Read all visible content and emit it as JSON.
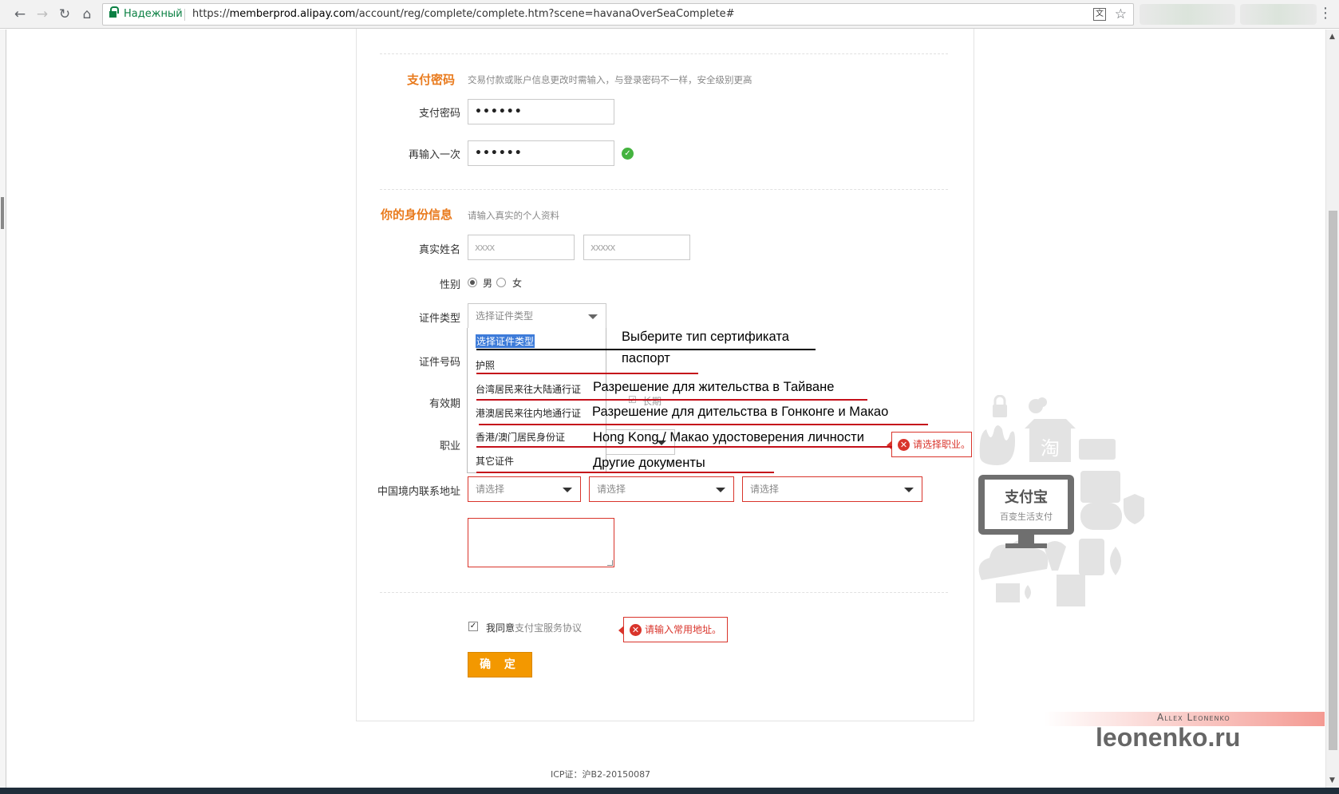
{
  "browser": {
    "secure_label": "Надежный",
    "url_prefix": "https://",
    "url_domain": "memberprod.alipay.com",
    "url_path": "/account/reg/complete/complete.htm?scene=havanaOverSeaComplete#"
  },
  "pay_password": {
    "title": "支付密码",
    "hint": "交易付款或账户信息更改时需输入，与登录密码不一样，安全级别更高",
    "label": "支付密码",
    "value": "••••••",
    "confirm_label": "再输入一次",
    "confirm_value": "••••••"
  },
  "identity": {
    "title": "你的身份信息",
    "hint": "请输入真实的个人资料",
    "real_name_label": "真实姓名",
    "first_name": "xxxx",
    "last_name": "xxxxx",
    "gender_label": "性别",
    "gender_male": "男",
    "gender_female": "女",
    "id_type_label": "证件类型",
    "id_type_placeholder": "选择证件类型",
    "id_type_options": [
      "选择证件类型",
      "护照",
      "台湾居民来往大陆通行证",
      "港澳居民来往内地通行证",
      "香港/澳门居民身份证",
      "其它证件"
    ],
    "id_number_label": "证件号码",
    "validity_label": "有效期",
    "validity_longterm": "长期",
    "occupation_label": "职业",
    "occupation_error": "请选择职业。",
    "address_label": "中国境内联系地址",
    "address_select_1": "请选择",
    "address_select_2": "请选择",
    "address_select_3": "请选择",
    "address_error": "请输入常用地址。"
  },
  "agreement": {
    "prefix": "我同意",
    "link": "支付宝服务协议"
  },
  "submit_label": "确 定",
  "icp": "ICP证：沪B2-20150087",
  "annotations": [
    "Выберите тип сертификата",
    "паспорт",
    "Разрешение для жительства в Тайване",
    "Разрешение для дительства в Гонконге и Макао",
    "Hong Kong / Макао удостоверения личности",
    "Другие документы"
  ],
  "illustration": {
    "brand": "支付宝",
    "slogan": "百变生活支付",
    "taobao_char": "淘"
  },
  "watermark": {
    "name": "Allex Leonenko",
    "site": "leonenko.ru"
  },
  "colors": {
    "accent": "#e97b1e",
    "error": "#d9342b",
    "submit": "#f39800",
    "annotation_line": "#c5101a"
  }
}
